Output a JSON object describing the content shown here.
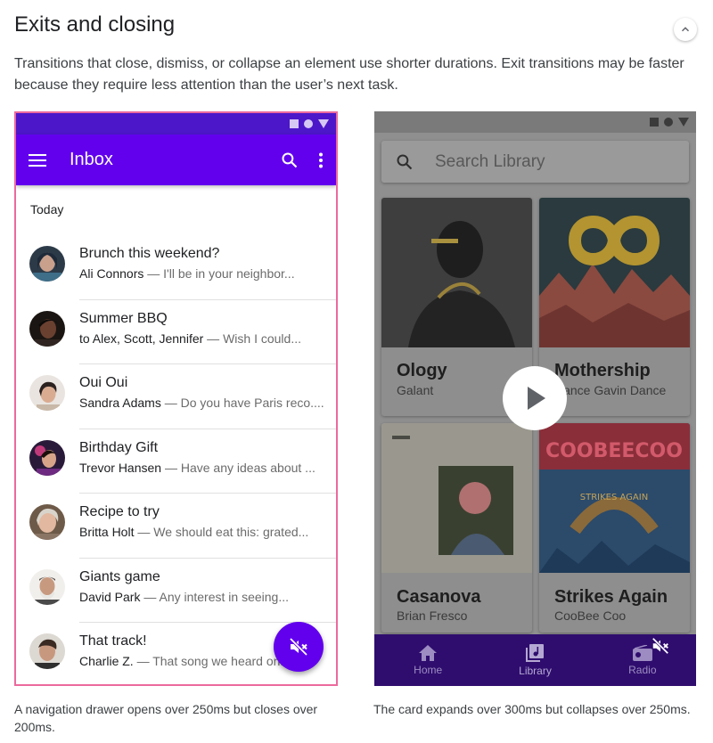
{
  "section": {
    "title": "Exits and closing",
    "intro": "Transitions that close, dismiss, or collapse an element use shorter durations. Exit transitions may be faster because they require less attention than the user’s next task."
  },
  "inbox_demo": {
    "app_title": "Inbox",
    "list_header": "Today",
    "emails": [
      {
        "subject": "Brunch this weekend?",
        "sender": "Ali Connors",
        "snippet": " — I'll be in your neighbor..."
      },
      {
        "subject": "Summer BBQ",
        "sender": "to Alex, Scott, Jennifer",
        "snippet": " — Wish I could..."
      },
      {
        "subject": "Oui Oui",
        "sender": "Sandra Adams",
        "snippet": " — Do you have Paris reco...."
      },
      {
        "subject": "Birthday Gift",
        "sender": "Trevor Hansen",
        "snippet": " — Have any ideas about ..."
      },
      {
        "subject": "Recipe to try",
        "sender": "Britta Holt",
        "snippet": " — We should eat this: grated..."
      },
      {
        "subject": "Giants game",
        "sender": "David Park",
        "snippet": " — Any interest in seeing..."
      },
      {
        "subject": "That track!",
        "sender": "Charlie Z.",
        "snippet": " — That song we heard on..."
      }
    ],
    "caption": "A navigation drawer opens over 250ms but closes over 200ms."
  },
  "music_demo": {
    "search_placeholder": "Search Library",
    "albums": [
      {
        "title": "Ology",
        "artist": "Galant"
      },
      {
        "title": "Mothership",
        "artist": "Dance Gavin Dance"
      },
      {
        "title": "Casanova",
        "artist": "Brian Fresco"
      },
      {
        "title": "Strikes Again",
        "artist": "CooBee Coo"
      }
    ],
    "art_text": {
      "strikes_again": "COOBEECOO",
      "strikes_again_sub": "STRIKES AGAIN"
    },
    "nav": [
      {
        "label": "Home"
      },
      {
        "label": "Library"
      },
      {
        "label": "Radio"
      }
    ],
    "caption": "The card expands over 300ms but collapses over 250ms."
  },
  "colors": {
    "primary": "#6200ee",
    "primary_dark": "#4c17c8",
    "highlight_border": "#ec6a9e"
  }
}
